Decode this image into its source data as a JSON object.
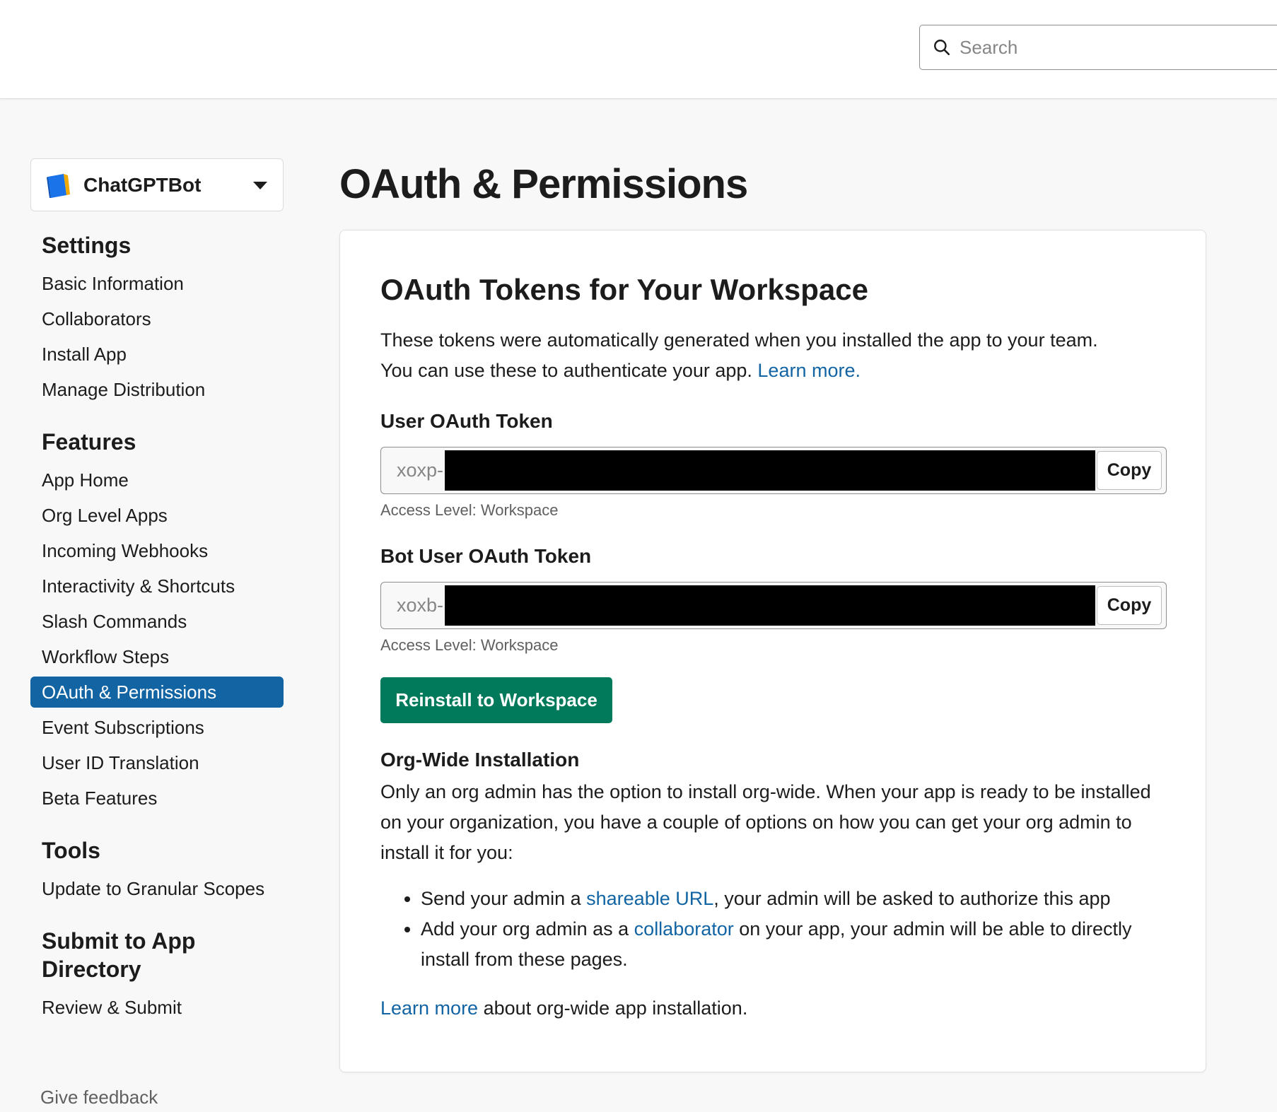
{
  "search": {
    "placeholder": "Search"
  },
  "app_switcher": {
    "name": "ChatGPTBot"
  },
  "sidebar": {
    "sections": [
      {
        "title": "Settings",
        "items": [
          "Basic Information",
          "Collaborators",
          "Install App",
          "Manage Distribution"
        ]
      },
      {
        "title": "Features",
        "items": [
          "App Home",
          "Org Level Apps",
          "Incoming Webhooks",
          "Interactivity & Shortcuts",
          "Slash Commands",
          "Workflow Steps",
          "OAuth & Permissions",
          "Event Subscriptions",
          "User ID Translation",
          "Beta Features"
        ]
      },
      {
        "title": "Tools",
        "items": [
          "Update to Granular Scopes"
        ]
      },
      {
        "title": "Submit to App Directory",
        "items": [
          "Review & Submit"
        ]
      }
    ],
    "active_item": "OAuth & Permissions",
    "feedback": "Give feedback"
  },
  "page": {
    "title": "OAuth & Permissions"
  },
  "tokens_card": {
    "title": "OAuth Tokens for Your Workspace",
    "desc_line1": "These tokens were automatically generated when you installed the app to your team.",
    "desc_line2": "You can use these to authenticate your app. ",
    "learn_more": "Learn more.",
    "user_token": {
      "label": "User OAuth Token",
      "prefix": "xoxp-",
      "copy": "Copy",
      "access": "Access Level: Workspace"
    },
    "bot_token": {
      "label": "Bot User OAuth Token",
      "prefix": "xoxb-",
      "copy": "Copy",
      "access": "Access Level: Workspace"
    },
    "reinstall_button": "Reinstall to Workspace",
    "org_wide": {
      "heading": "Org-Wide Installation",
      "paragraph": "Only an org admin has the option to install org-wide. When your app is ready to be installed on your organization, you have a couple of options on how you can get your org admin to install it for you:",
      "bullet1_pre": "Send your admin a ",
      "bullet1_link": "shareable URL",
      "bullet1_post": ", your admin will be asked to authorize this app",
      "bullet2_pre": "Add your org admin as a ",
      "bullet2_link": "collaborator",
      "bullet2_post": " on your app, your admin will be able to directly install from these pages.",
      "footer_link": "Learn more",
      "footer_post": " about org-wide app installation."
    }
  },
  "colors": {
    "accent": "#1264a3",
    "button_green": "#007a5a",
    "link": "#1264a3"
  }
}
